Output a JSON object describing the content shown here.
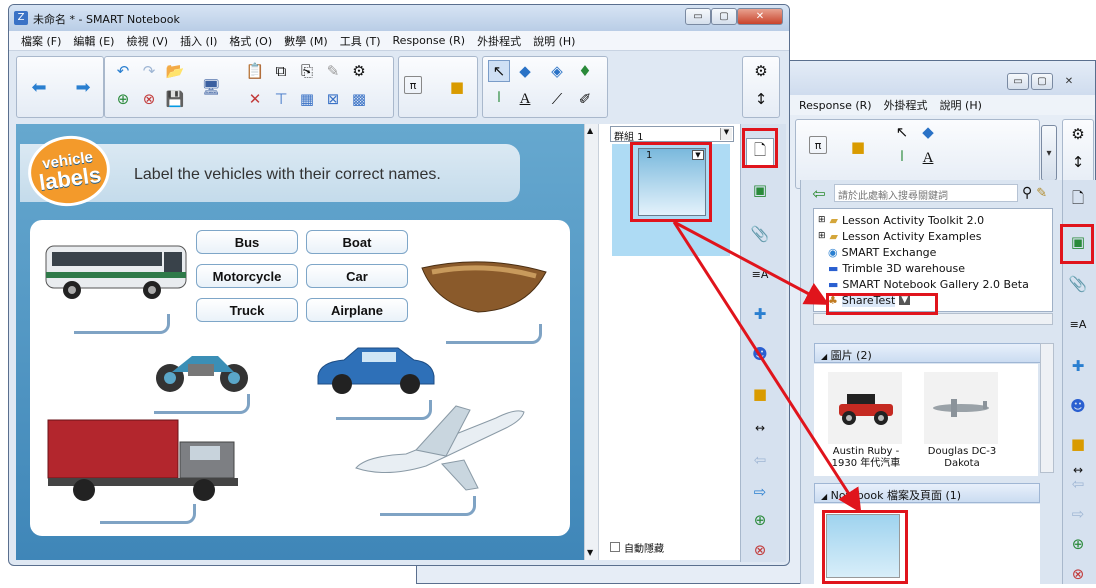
{
  "main_window": {
    "title": "未命名 * - SMART Notebook",
    "menu": [
      "檔案 (F)",
      "編輯 (E)",
      "檢視 (V)",
      "插入 (I)",
      "格式 (O)",
      "數學 (M)",
      "工具 (T)",
      "Response (R)",
      "外掛程式",
      "說明 (H)"
    ],
    "page_group": "群組 1",
    "page_number": "1",
    "auto_hide": "自動隱藏"
  },
  "lesson": {
    "badge_line1": "vehicle",
    "badge_line2": "labels",
    "instruction": "Label the vehicles with their correct names.",
    "labels": [
      "Bus",
      "Boat",
      "Motorcycle",
      "Car",
      "Truck",
      "Airplane"
    ]
  },
  "second_window": {
    "menu": [
      "Response (R)",
      "外掛程式",
      "說明 (H)"
    ],
    "search_placeholder": "請於此處輸入搜尋關鍵詞",
    "tree": [
      "Lesson Activity Toolkit 2.0",
      "Lesson Activity Examples",
      "SMART Exchange",
      "Trimble 3D warehouse",
      "SMART Notebook Gallery 2.0 Beta",
      "ShareTest"
    ],
    "pictures_header": "圖片 (2)",
    "pictures": [
      {
        "caption1": "Austin Ruby -",
        "caption2": "1930 年代汽車"
      },
      {
        "caption1": "Douglas DC-3",
        "caption2": "Dakota"
      }
    ],
    "files_header": "Notebook 檔案及頁面 (1)"
  },
  "colors": {
    "highlight": "#e0141c",
    "lesson_blue": "#3a84b4",
    "page_bg": "#a8d8f0"
  }
}
